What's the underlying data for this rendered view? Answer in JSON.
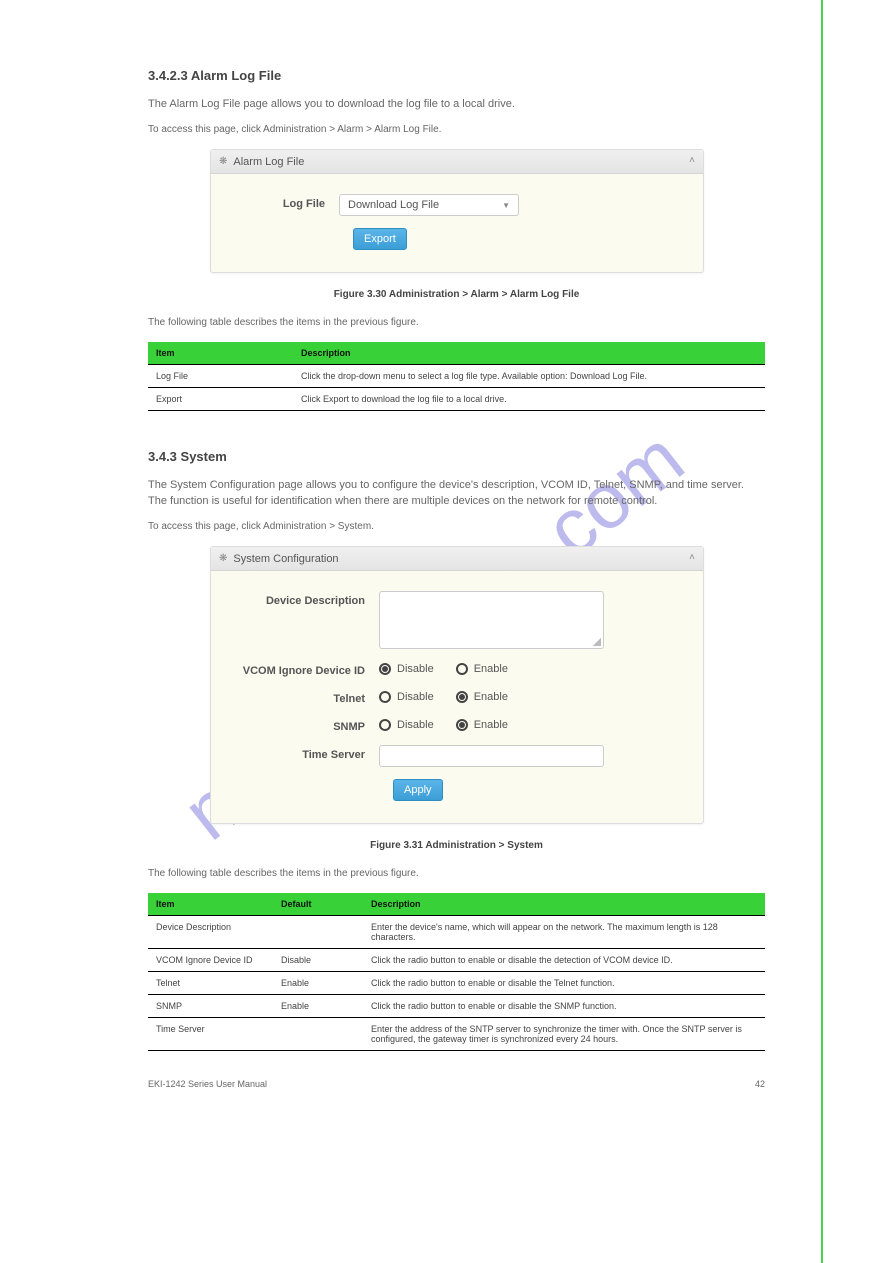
{
  "watermark_text": "manualshive.com",
  "section1": {
    "title": "3.4.2.3 Alarm Log File",
    "desc": "The Alarm Log File page allows you to download the log file to a local drive.",
    "nav": "To access this page, click Administration > Alarm > Alarm Log File."
  },
  "panel1": {
    "header": "Alarm Log File",
    "label": "Log File",
    "select_value": "Download Log File",
    "button": "Export"
  },
  "figure1": "Figure 3.30 Administration > Alarm > Alarm Log File",
  "table1": {
    "header": {
      "item": "Item",
      "desc": "Description"
    },
    "rows": [
      {
        "item": "Log File",
        "desc": "Click the drop-down menu to select a log file type. Available option: Download Log File."
      },
      {
        "item": "Export",
        "desc": "Click Export to download the log file to a local drive."
      }
    ]
  },
  "section2": {
    "title": "3.4.3 System",
    "desc": "The System Configuration page allows you to configure the device's description, VCOM ID, Telnet, SNMP, and time server. The function is useful for identification when there are multiple devices on the network for remote control.",
    "nav": "To access this page, click Administration > System."
  },
  "panel2": {
    "header": "System Configuration",
    "labels": {
      "device_description": "Device Description",
      "vcom": "VCOM Ignore Device ID",
      "telnet": "Telnet",
      "snmp": "SNMP",
      "time_server": "Time Server"
    },
    "radio": {
      "disable": "Disable",
      "enable": "Enable"
    },
    "button": "Apply"
  },
  "figure2": "Figure 3.31 Administration > System",
  "table2": {
    "header": {
      "item": "Item",
      "default": "Default",
      "desc": "Description"
    },
    "rows": [
      {
        "item": "Device Description",
        "default": "",
        "desc": "Enter the device's name, which will appear on the network. The maximum length is 128 characters."
      },
      {
        "item": "VCOM Ignore Device ID",
        "default": "Disable",
        "desc": "Click the radio button to enable or disable the detection of VCOM device ID."
      },
      {
        "item": "Telnet",
        "default": "Enable",
        "desc": "Click the radio button to enable or disable the Telnet function."
      },
      {
        "item": "SNMP",
        "default": "Enable",
        "desc": "Click the radio button to enable or disable the SNMP function."
      },
      {
        "item": "Time Server",
        "default": "",
        "desc": "Enter the address of the SNTP server to synchronize the timer with. Once the SNTP server is configured, the gateway timer is synchronized every 24 hours."
      }
    ]
  },
  "footer": {
    "left": "EKI-1242 Series User Manual",
    "right": "42"
  }
}
